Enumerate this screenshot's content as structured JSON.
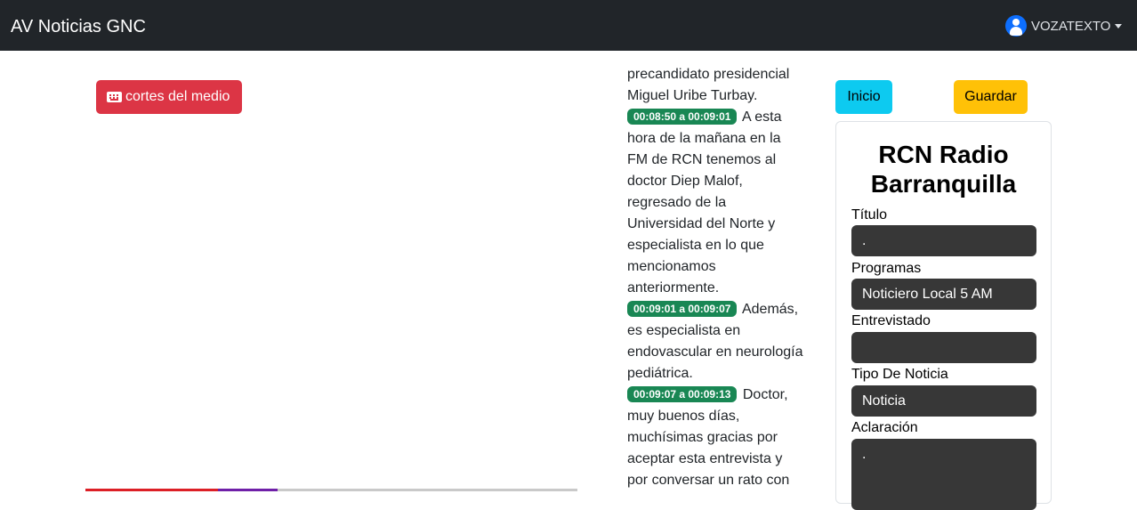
{
  "navbar": {
    "brand": "AV Noticias GNC",
    "user": "VOZATEXTO",
    "user_icon": "user-circle-icon"
  },
  "media": {
    "cortes_button": "cortes del medio",
    "cortes_icon": "keyboard-icon",
    "progress_played": 0.27,
    "progress_buffered": 0.39
  },
  "transcript": {
    "lead_text": "precandidato presidencial Miguel Uribe Turbay.",
    "segments": [
      {
        "time": "00:08:50 a 00:09:01",
        "text": "A esta hora de la mañana en la FM de RCN tenemos al doctor Diep Malof, regresado de la Universidad del Norte y especialista en lo que mencionamos anteriormente."
      },
      {
        "time": "00:09:01 a 00:09:07",
        "text": "Además, es especialista en endovascular en neurología pediátrica."
      },
      {
        "time": "00:09:07 a 00:09:13",
        "text": "Doctor, muy buenos días, muchísimas gracias por aceptar esta entrevista y por conversar un rato con"
      }
    ]
  },
  "actions": {
    "inicio": "Inicio",
    "guardar": "Guardar"
  },
  "form": {
    "station": "RCN Radio Barranquilla",
    "titulo_label": "Título",
    "titulo_value": ".",
    "programas_label": "Programas",
    "programas_value": "Noticiero Local 5 AM",
    "entrevistado_label": "Entrevistado",
    "entrevistado_value": "",
    "tipo_label": "Tipo De Noticia",
    "tipo_value": "Noticia",
    "aclaracion_label": "Aclaración",
    "aclaracion_value": "."
  },
  "colors": {
    "navbar": "#212529",
    "danger": "#dc3545",
    "success": "#198754",
    "info": "#0dcaf0",
    "warning": "#ffc107",
    "field_bg": "#373737"
  }
}
